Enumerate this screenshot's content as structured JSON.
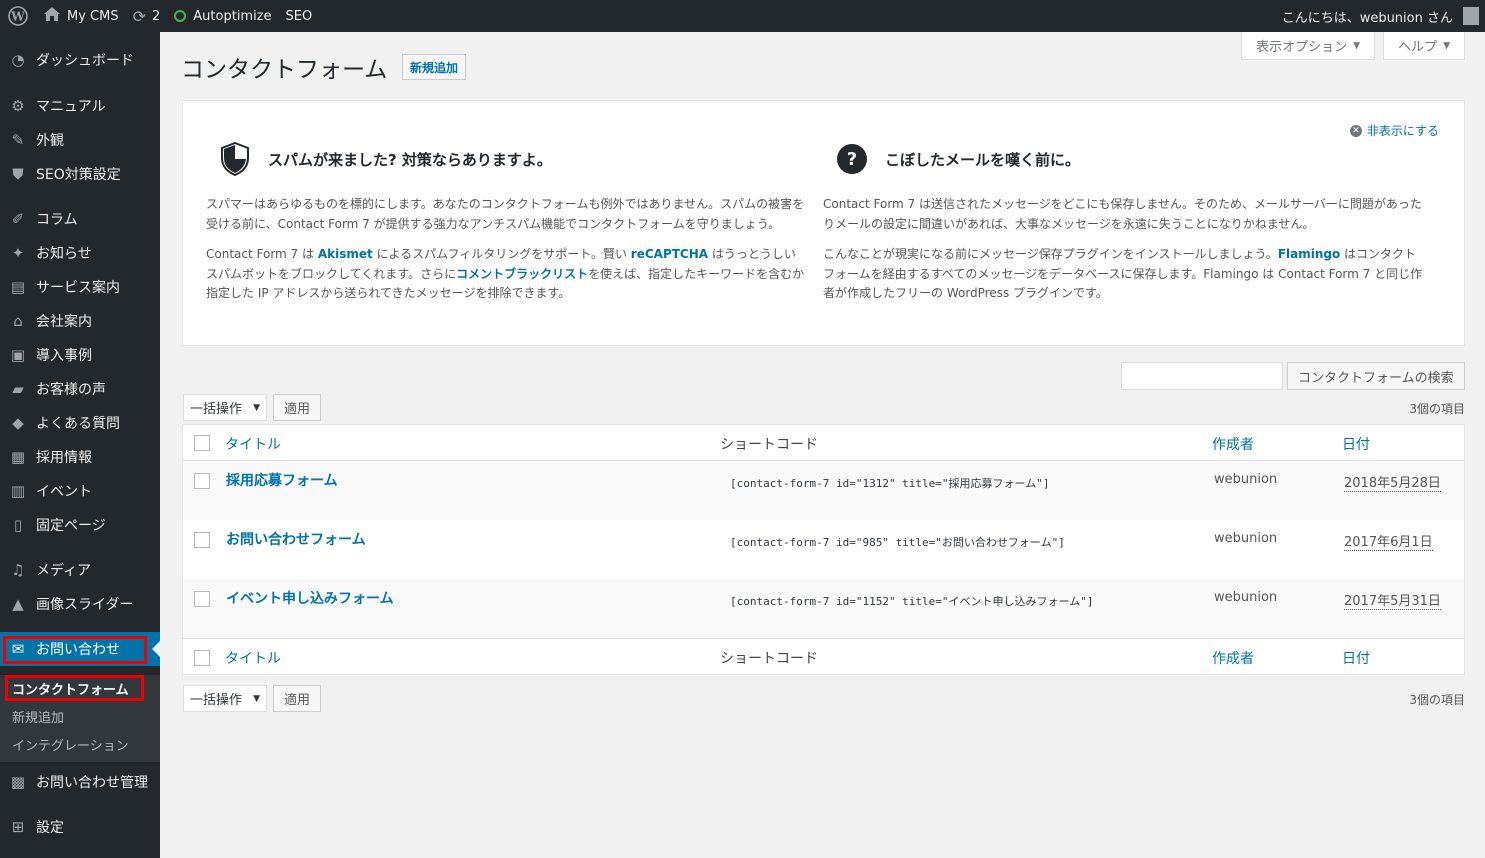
{
  "adminbar": {
    "site_name": "My CMS",
    "updates_count": "2",
    "autoptimize": "Autoptimize",
    "seo": "SEO",
    "greeting": "こんにちは、webunion さん"
  },
  "sidebar": {
    "items": [
      {
        "label": "ダッシュボード",
        "icon": "dashboard-icon"
      },
      {
        "label": "マニュアル",
        "icon": "gear-icon"
      },
      {
        "label": "外観",
        "icon": "brush-icon"
      },
      {
        "label": "SEO対策設定",
        "icon": "shield-icon"
      },
      {
        "label": "コラム",
        "icon": "edit-icon"
      },
      {
        "label": "お知らせ",
        "icon": "pin-icon"
      },
      {
        "label": "サービス案内",
        "icon": "book-icon"
      },
      {
        "label": "会社案内",
        "icon": "store-icon"
      },
      {
        "label": "導入事例",
        "icon": "images-icon"
      },
      {
        "label": "お客様の声",
        "icon": "comments-icon"
      },
      {
        "label": "よくある質問",
        "icon": "tag-icon"
      },
      {
        "label": "採用情報",
        "icon": "id-card-icon"
      },
      {
        "label": "イベント",
        "icon": "calendar-icon"
      },
      {
        "label": "固定ページ",
        "icon": "page-icon"
      },
      {
        "label": "メディア",
        "icon": "media-icon"
      },
      {
        "label": "画像スライダー",
        "icon": "mountain-icon"
      },
      {
        "label": "お問い合わせ",
        "icon": "mail-icon"
      },
      {
        "label": "お問い合わせ管理",
        "icon": "inbox-icon"
      },
      {
        "label": "設定",
        "icon": "settings-icon"
      }
    ],
    "submenu": [
      "コンタクトフォーム",
      "新規追加",
      "インテグレーション"
    ]
  },
  "header": {
    "screen_options": "表示オプション",
    "help": "ヘルプ",
    "title": "コンタクトフォーム",
    "add_new": "新規追加"
  },
  "welcome": {
    "dismiss": "非表示にする",
    "spam": {
      "title": "スパムが来ました? 対策ならありますよ。",
      "p1": "スパマーはあらゆるものを標的にします。あなたのコンタクトフォームも例外ではありません。スパムの被害を受ける前に、Contact Form 7 が提供する強力なアンチスパム機能でコンタクトフォームを守りましょう。",
      "p2_a": "Contact Form 7 は ",
      "p2_akismet": "Akismet",
      "p2_b": " によるスパムフィルタリングをサポート。賢い ",
      "p2_recaptcha": "reCAPTCHA",
      "p2_c": " はうっとうしいスパムボットをブロックしてくれます。さらに",
      "p2_blacklist": "コメントブラックリスト",
      "p2_d": "を使えば、指定したキーワードを含むか指定した IP アドレスから送られてきたメッセージを排除できます。"
    },
    "mail": {
      "title": "こぼしたメールを嘆く前に。",
      "p1": "Contact Form 7 は送信されたメッセージをどこにも保存しません。そのため、メールサーバーに問題があったりメールの設定に間違いがあれば、大事なメッセージを永遠に失うことになりかねません。",
      "p2_a": "こんなことが現実になる前にメッセージ保存プラグインをインストールしましょう。",
      "p2_flamingo": "Flamingo",
      "p2_b": " はコンタクトフォームを経由するすべてのメッセージをデータベースに保存します。Flamingo は Contact Form 7 と同じ作者が作成したフリーの WordPress プラグインです。"
    }
  },
  "search": {
    "input_value": "",
    "button": "コンタクトフォームの検索"
  },
  "bulk": {
    "select": "一括操作",
    "apply": "適用",
    "count": "3個の項目"
  },
  "table": {
    "columns": {
      "title": "タイトル",
      "shortcode": "ショートコード",
      "author": "作成者",
      "date": "日付"
    },
    "rows": [
      {
        "title": "採用応募フォーム",
        "shortcode": "[contact-form-7 id=\"1312\" title=\"採用応募フォーム\"]",
        "author": "webunion",
        "date": "2018年5月28日"
      },
      {
        "title": "お問い合わせフォーム",
        "shortcode": "[contact-form-7 id=\"985\" title=\"お問い合わせフォーム\"]",
        "author": "webunion",
        "date": "2017年6月1日"
      },
      {
        "title": "イベント申し込みフォーム",
        "shortcode": "[contact-form-7 id=\"1152\" title=\"イベント申し込みフォーム\"]",
        "author": "webunion",
        "date": "2017年5月31日"
      }
    ]
  },
  "colors": {
    "adminbar_bg": "#23282d",
    "accent": "#0073aa",
    "highlight_border": "#ee0000"
  }
}
